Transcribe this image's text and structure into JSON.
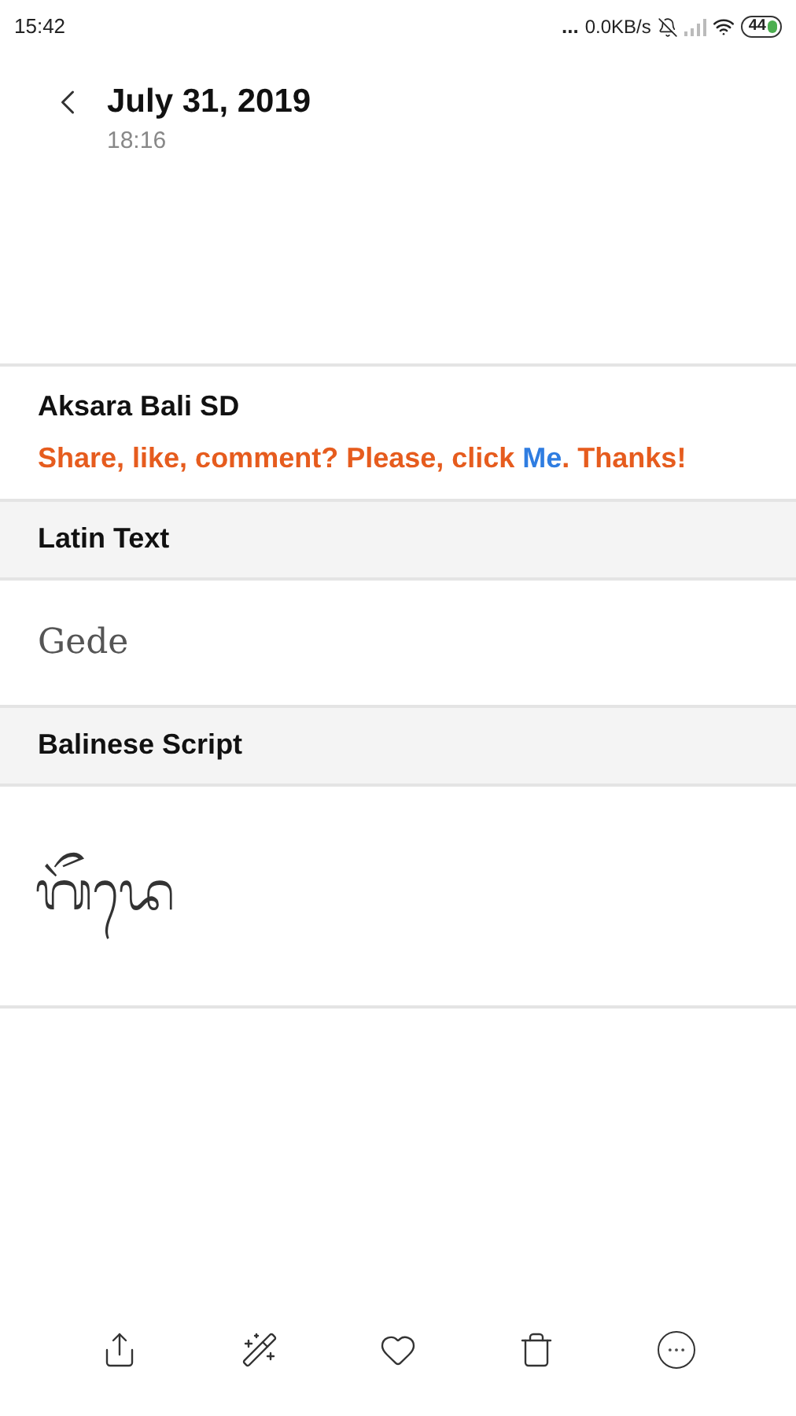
{
  "status_bar": {
    "time": "15:42",
    "dots": "...",
    "speed": "0.0KB/s",
    "battery": "44"
  },
  "header": {
    "title": "July 31, 2019",
    "subtitle": "18:16"
  },
  "app": {
    "name": "Aksara Bali SD",
    "promo_before": "Share, like, comment? Please, click ",
    "promo_link": "Me",
    "promo_after": ". Thanks!"
  },
  "sections": [
    {
      "heading": "Latin Text",
      "kind": "latin",
      "content": "Gede"
    },
    {
      "heading": "Balinese Script",
      "kind": "balinese",
      "content": "ᬕᭂᬤᬾ"
    }
  ]
}
